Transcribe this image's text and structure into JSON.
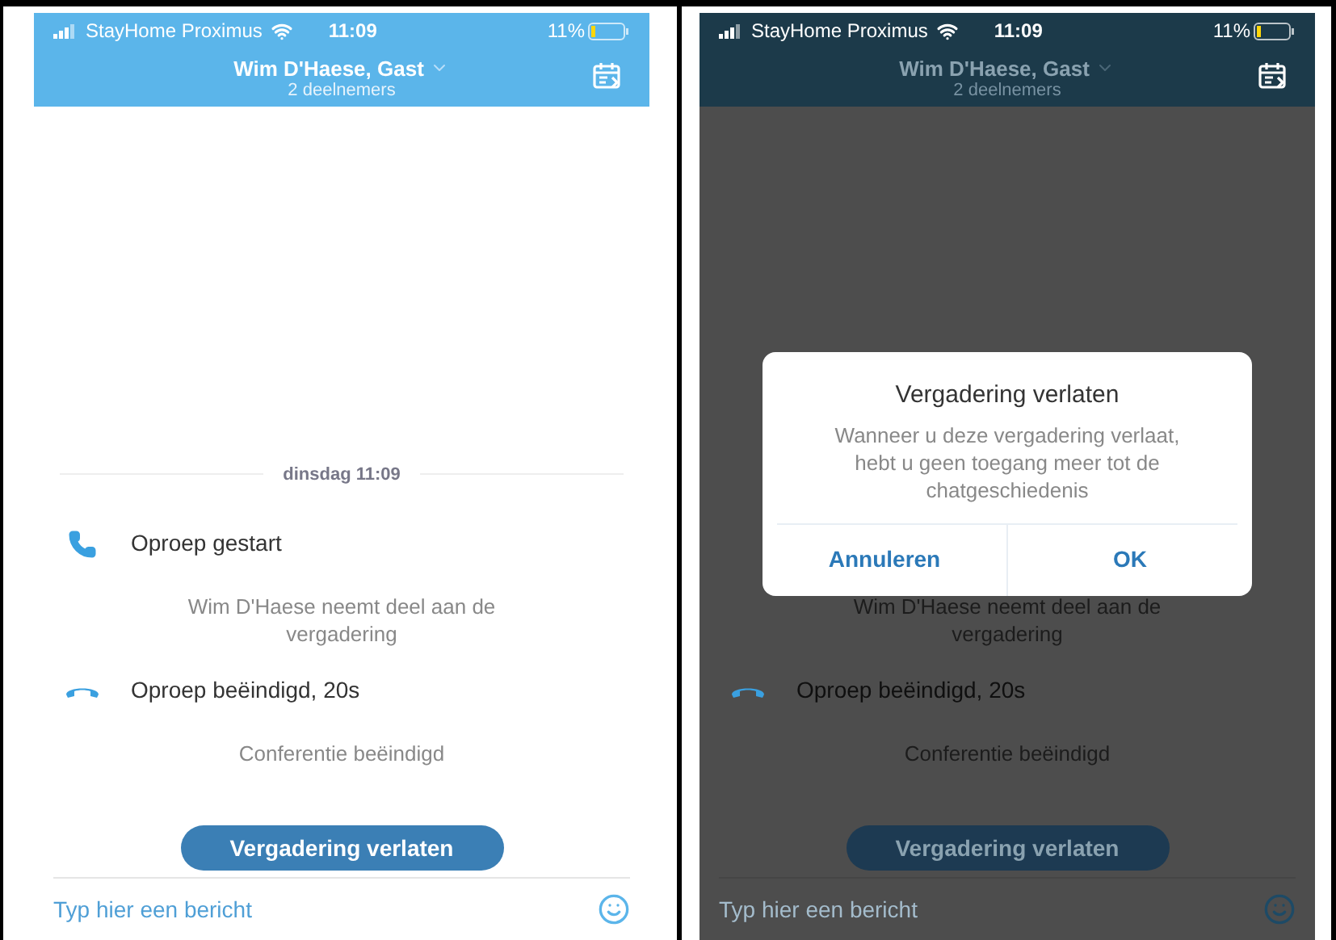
{
  "screens": [
    {
      "status_bar": {
        "carrier": "StayHome Proximus",
        "time": "11:09",
        "battery": "11%"
      },
      "header": {
        "title": "Wim D'Haese, Gast",
        "subtitle": "2 deelnemers"
      },
      "date_divider": "dinsdag 11:09",
      "events": [
        {
          "kind": "call_start",
          "text": "Oproep gestart"
        },
        {
          "kind": "notice",
          "text": "Wim D'Haese neemt deel aan de vergadering"
        },
        {
          "kind": "call_end",
          "text": "Oproep beëindigd, 20s"
        },
        {
          "kind": "notice",
          "text": "Conferentie beëindigd"
        }
      ],
      "leave_button": "Vergadering verlaten",
      "composer": {
        "placeholder": "Typ hier een bericht"
      }
    },
    {
      "status_bar": {
        "carrier": "StayHome Proximus",
        "time": "11:09",
        "battery": "11%"
      },
      "header": {
        "title": "Wim D'Haese, Gast",
        "subtitle": "2 deelnemers"
      },
      "events": [
        {
          "kind": "notice",
          "text": "Wim D'Haese neemt deel aan de vergadering"
        },
        {
          "kind": "call_end",
          "text": "Oproep beëindigd, 20s"
        },
        {
          "kind": "notice",
          "text": "Conferentie beëindigd"
        }
      ],
      "leave_button": "Vergadering verlaten",
      "composer": {
        "placeholder": "Typ hier een bericht"
      },
      "dialog": {
        "title": "Vergadering verlaten",
        "message": "Wanneer u deze vergadering verlaat, hebt u geen toegang meer tot de chatgeschiedenis",
        "buttons": [
          "Annuleren",
          "OK"
        ]
      }
    }
  ]
}
